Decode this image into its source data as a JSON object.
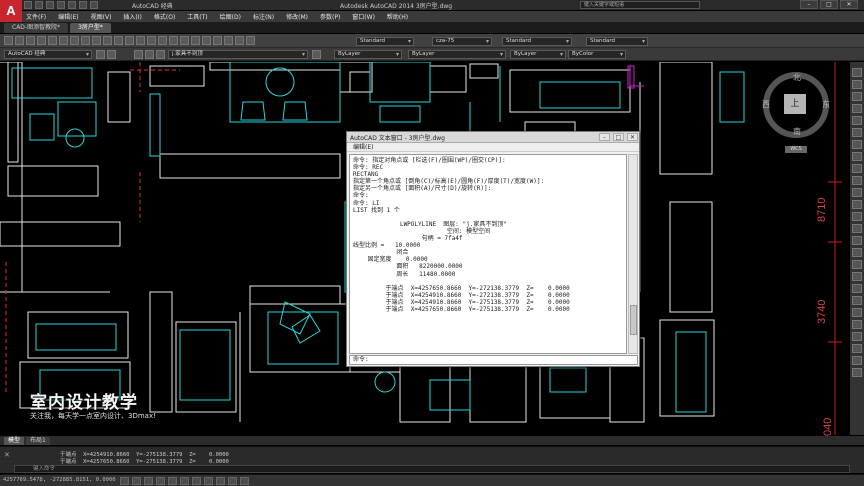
{
  "window": {
    "app_logo": "A",
    "workspace": "AutoCAD 经典",
    "title": "Autodesk AutoCAD 2014  3房户型.dwg",
    "search_placeholder": "键入关键字或短语",
    "min": "–",
    "max": "□",
    "close": "✕"
  },
  "menus": [
    "文件(F)",
    "编辑(E)",
    "视图(V)",
    "插入(I)",
    "格式(O)",
    "工具(T)",
    "绘图(D)",
    "标注(N)",
    "修改(M)",
    "参数(P)",
    "窗口(W)",
    "帮助(H)"
  ],
  "tabs": [
    {
      "label": "CAD-图添智教院*",
      "active": false
    },
    {
      "label": "3房户型*",
      "active": true
    }
  ],
  "toolbar": {
    "workspace_select": "AutoCAD 经典",
    "text_style": "Standard",
    "dim_style": "cza-75",
    "table_style": "Standard",
    "mleader_style": "Standard",
    "layer_select": "j.家具不到顶",
    "color_select": "ByLayer",
    "linetype_select": "ByLayer",
    "lineweight_select": "ByLayer",
    "plotstyle_select": "ByColor"
  },
  "text_window": {
    "title": "AutoCAD 文本窗口 - 3房户型.dwg",
    "menu": "编辑(E)",
    "lines": [
      "命令: 指定对角点或 [栏选(F)/圈围(WP)/圈交(CP)]:",
      "命令: REC",
      "RECTANG",
      "指定第一个角点或 [倒角(C)/标高(E)/圆角(F)/厚度(T)/宽度(W)]:",
      "指定另一个角点或 [面积(A)/尺寸(D)/旋转(R)]:",
      "命令:",
      "命令: LI",
      "LIST 找到 1 个",
      "",
      "             LWPOLYLINE  图层: \"j.家具不到顶\"",
      "                          空间: 模型空间",
      "                   句柄 = 7fa4f",
      "线型比例 =   10.0000",
      "            闭合",
      "    固定宽度    0.0000",
      "            面积   8220000.0000",
      "            周长   11480.0000",
      "",
      "         于端点  X=4257650.8660  Y=-272138.3779  Z=    0.0000",
      "         于端点  X=4254910.8660  Y=-272138.3779  Z=    0.0000",
      "         于端点  X=4254910.8660  Y=-275138.3779  Z=    0.0000",
      "         于端点  X=4257650.8660  Y=-275138.3779  Z=    0.0000"
    ],
    "prompt": "命令:"
  },
  "compass": {
    "north": "北",
    "south": "南",
    "east": "东",
    "west": "西",
    "face": "上",
    "wcs": "WCS"
  },
  "dimensions": [
    "8710",
    "3740",
    "040"
  ],
  "watermark": {
    "title": "室内设计教学",
    "subtitle": "关注我，每天学一点室内设计、3Dmax!"
  },
  "layout_tabs": [
    {
      "label": "模型",
      "active": true
    },
    {
      "label": "布局1",
      "active": false
    }
  ],
  "command_history": [
    "于端点  X=4254910.8660  Y=-275138.3779  Z=    0.0000",
    "于端点  X=4257650.8660  Y=-275138.3779  Z=    0.0000"
  ],
  "command_input_placeholder": "键入命令",
  "status": {
    "coords": "4257769.5478, -272885.8151, 0.0000"
  }
}
